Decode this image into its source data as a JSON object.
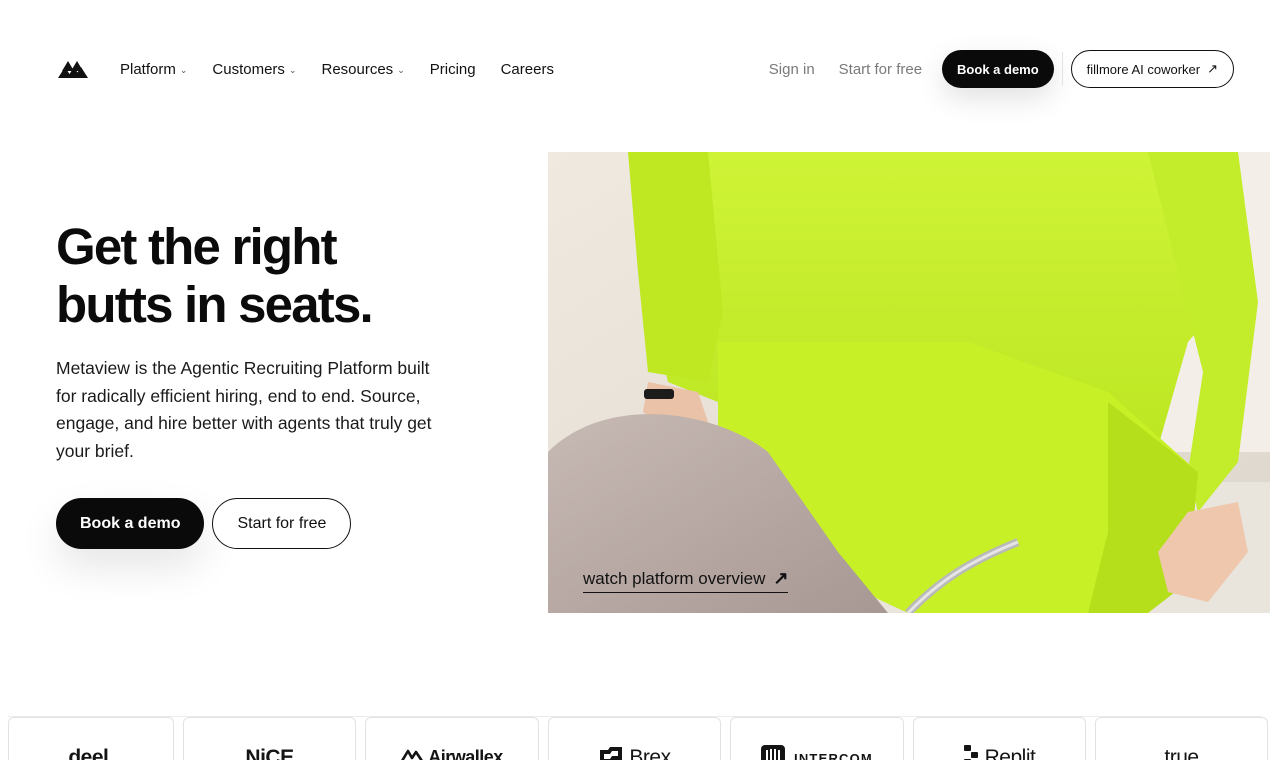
{
  "nav": {
    "links": [
      {
        "label": "Platform",
        "dropdown": true
      },
      {
        "label": "Customers",
        "dropdown": true
      },
      {
        "label": "Resources",
        "dropdown": true
      },
      {
        "label": "Pricing",
        "dropdown": false
      },
      {
        "label": "Careers",
        "dropdown": false
      }
    ],
    "sign_in": "Sign in",
    "start_free": "Start for free",
    "book_demo": "Book a demo",
    "ai_coworker": "fillmore AI coworker",
    "ai_arrow": "↗",
    "chevron": "⌄"
  },
  "hero": {
    "title": "Get the right\nbutts in seats.",
    "description": "Metaview is the Agentic Recruiting Platform built for radically efficient hiring, end to end. Source, engage, and hire better with agents that truly get your brief.",
    "book_demo": "Book a demo",
    "start_free": "Start for free",
    "watch_label": "watch platform overview",
    "watch_arrow": "↗"
  },
  "logos": [
    "deel.",
    "NiCE",
    "Airwallex",
    "Brex",
    "INTERCOM",
    "Replit",
    "true"
  ],
  "colors": {
    "accent": "#0a0a0a",
    "hoodie": "#c9f02a",
    "background": "#ffffff"
  }
}
